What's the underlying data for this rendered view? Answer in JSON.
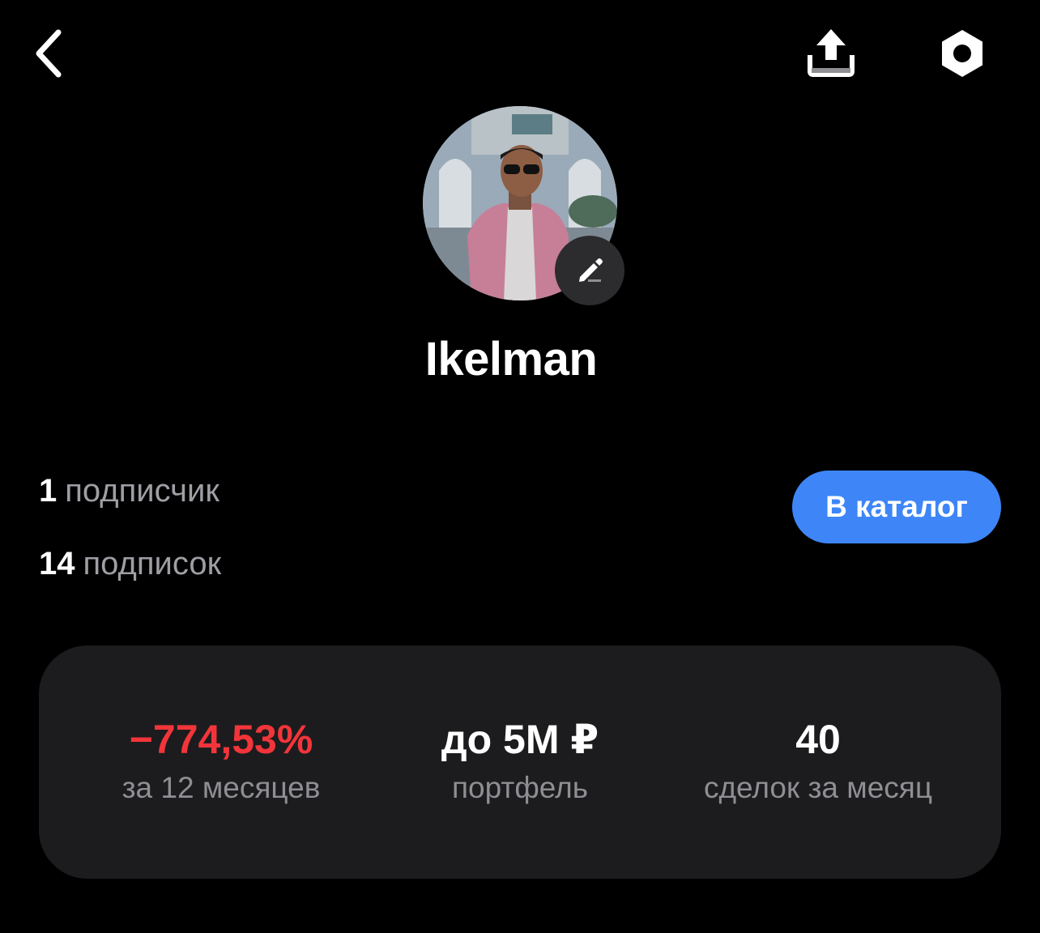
{
  "header": {
    "back_icon": "chevron-left-icon",
    "share_icon": "share-upload-icon",
    "settings_icon": "hexagon-settings-icon"
  },
  "profile": {
    "username": "Ikelman",
    "edit_icon": "pencil-icon"
  },
  "counts": {
    "followers_count": "1",
    "followers_label": "подписчик",
    "following_count": "14",
    "following_label": "подписок"
  },
  "catalog_button": {
    "label": "В каталог",
    "color": "#3e86f7"
  },
  "stats": {
    "return_value": "−774,53%",
    "return_caption": "за 12 месяцев",
    "return_color": "#f2353a",
    "portfolio_value": "до 5M ₽",
    "portfolio_caption": "портфель",
    "trades_value": "40",
    "trades_caption": "сделок за месяц"
  }
}
